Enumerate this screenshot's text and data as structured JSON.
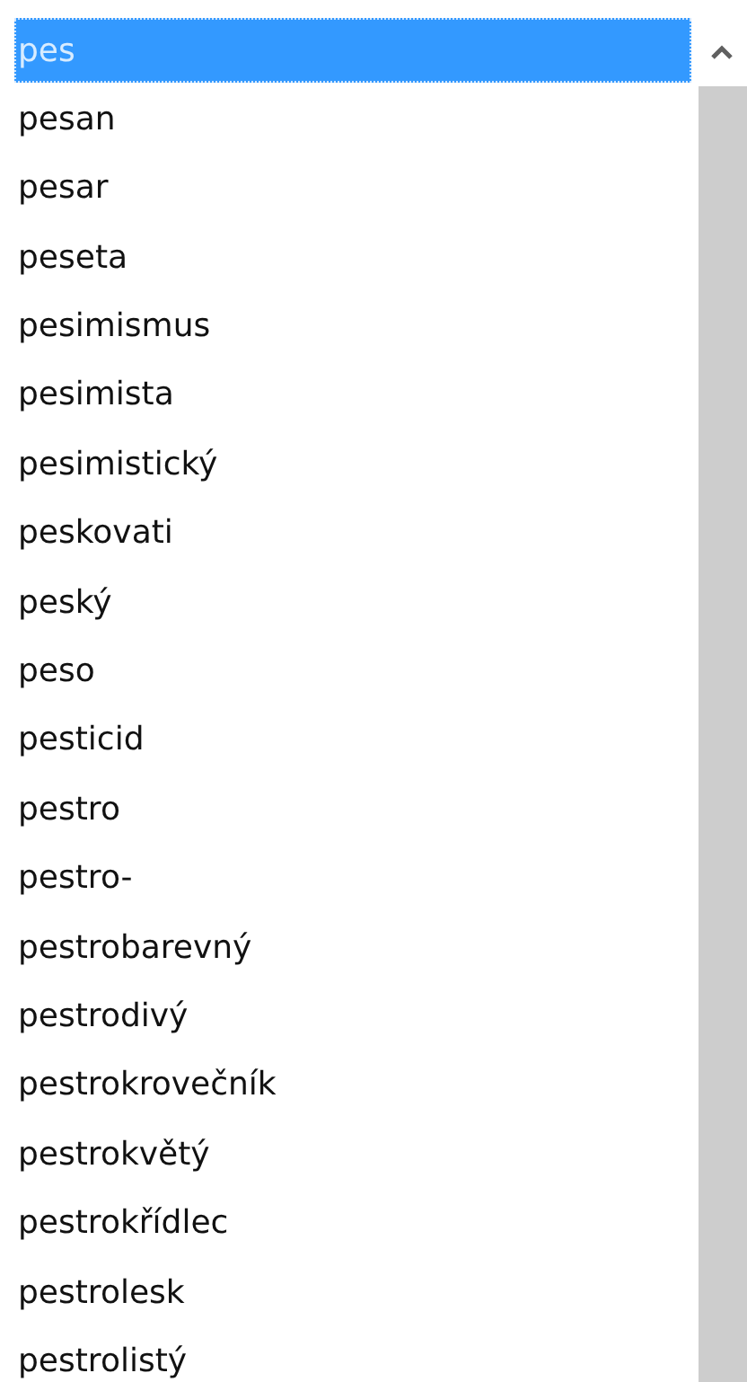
{
  "list": {
    "items": [
      {
        "label": "pes",
        "selected": true
      },
      {
        "label": "pesan",
        "selected": false
      },
      {
        "label": "pesar",
        "selected": false
      },
      {
        "label": "peseta",
        "selected": false
      },
      {
        "label": "pesimismus",
        "selected": false
      },
      {
        "label": "pesimista",
        "selected": false
      },
      {
        "label": "pesimistický",
        "selected": false
      },
      {
        "label": "peskovati",
        "selected": false
      },
      {
        "label": "peský",
        "selected": false
      },
      {
        "label": "peso",
        "selected": false
      },
      {
        "label": "pesticid",
        "selected": false
      },
      {
        "label": "pestro",
        "selected": false
      },
      {
        "label": "pestro-",
        "selected": false
      },
      {
        "label": "pestrobarevný",
        "selected": false
      },
      {
        "label": "pestrodivý",
        "selected": false
      },
      {
        "label": "pestrokrovečník",
        "selected": false
      },
      {
        "label": "pestrokvětý",
        "selected": false
      },
      {
        "label": "pestrokřídlec",
        "selected": false
      },
      {
        "label": "pestrolesk",
        "selected": false
      },
      {
        "label": "pestrolistý",
        "selected": false
      }
    ]
  }
}
